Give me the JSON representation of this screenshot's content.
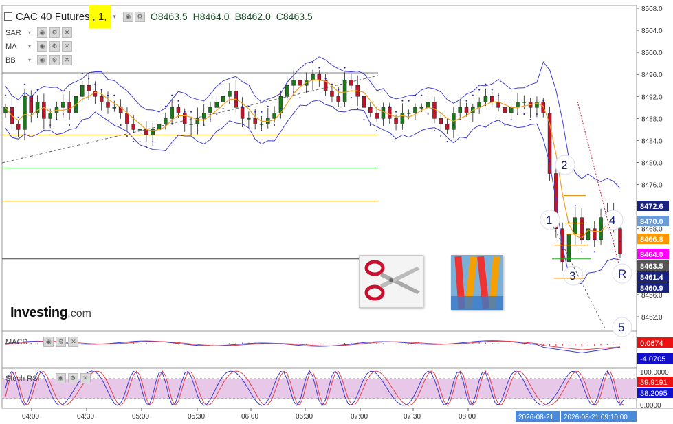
{
  "header": {
    "symbol_label": "CAC 40 Futures",
    "interval_label": ", 1,",
    "open": "O8463.5",
    "high": "H8464.0",
    "low": "B8462.0",
    "close": "C8463.5"
  },
  "indicators": [
    "SAR",
    "MA",
    "BB"
  ],
  "logo": "Investing",
  "logo_suffix": ".com",
  "macd_label": "MACD",
  "stoch_label": "Stoch RSI",
  "colors": {
    "up": "#1a7a1a",
    "down": "#c0142b",
    "bb": "#4040d0",
    "ma": "#f0a020",
    "sar": "#2222aa",
    "macd_line": "#3a3ad0",
    "signal_line": "#e0404a",
    "stoch_fill": "#e8c8e8",
    "yellow_line": "#d4a000",
    "green_line": "#22aa22",
    "orange_line": "#e08800"
  },
  "chart_data": [
    {
      "type": "candlestick",
      "title": "CAC 40 Futures, 1",
      "y_ticks": [
        "8508.0",
        "8504.0",
        "8500.0",
        "8496.0",
        "8492.0",
        "8488.0",
        "8484.0",
        "8480.0",
        "8476.0",
        "8472.0",
        "8468.0",
        "8464.0",
        "8460.0",
        "8456.0",
        "8452.0"
      ],
      "ylim": [
        8450,
        8509
      ],
      "x_ticks": [
        "04:00",
        "04:30",
        "05:00",
        "05:30",
        "06:00",
        "06:30",
        "07:00",
        "07:30",
        "08:00",
        "2026-08-21",
        "2026-08-21  09:10:00"
      ],
      "price_tags": [
        {
          "value": "8472.6",
          "color": "#1a237e"
        },
        {
          "value": "8470.0",
          "color": "#6a9bd8"
        },
        {
          "value": "8466.8",
          "color": "#ff9800"
        },
        {
          "value": "8464.0",
          "color": "#ff00ff"
        },
        {
          "value": "8463.5",
          "color": "#555555"
        },
        {
          "value": "8461.4",
          "color": "#1a237e"
        },
        {
          "value": "8460.9",
          "color": "#1a237e"
        }
      ],
      "horizontal_levels": [
        8485,
        8479,
        8473,
        8462.5
      ],
      "wave_labels": [
        "1",
        "2",
        "3",
        "4",
        "5",
        "R"
      ],
      "close_path": [
        8490,
        8487,
        8486,
        8492,
        8489,
        8491,
        8488,
        8489,
        8490,
        8491,
        8489,
        8492,
        8494,
        8493,
        8492,
        8491,
        8490,
        8490,
        8489,
        8487,
        8486,
        8486,
        8485,
        8486,
        8487,
        8488,
        8490,
        8489,
        8487,
        8487,
        8488,
        8489,
        8490,
        8491,
        8492,
        8493,
        8490,
        8488,
        8488,
        8487,
        8487,
        8488,
        8489,
        8492,
        8494,
        8495,
        8494,
        8495,
        8496,
        8495,
        8493,
        8492,
        8491,
        8495,
        8494,
        8492,
        8490,
        8489,
        8488,
        8490,
        8488,
        8487,
        8489,
        8489,
        8490,
        8490,
        8491,
        8488,
        8487,
        8486,
        8489,
        8490,
        8489,
        8490,
        8491,
        8492,
        8491,
        8490,
        8489,
        8490,
        8491,
        8491,
        8490,
        8491,
        8489,
        8478,
        8468,
        8462,
        8467,
        8470,
        8466,
        8468,
        8466,
        8470,
        8471,
        8468,
        8463.5
      ],
      "legend": null
    },
    {
      "type": "line",
      "title": "MACD",
      "series": [
        {
          "name": "0.0674",
          "color": "#3a3ad0"
        },
        {
          "name": "-4.0705",
          "color": "#e0404a"
        }
      ],
      "tags": [
        "0.0674",
        "-4.0705"
      ]
    },
    {
      "type": "line",
      "title": "Stoch RSI",
      "y_ticks": [
        "100.0000",
        "0.0000"
      ],
      "series": [
        {
          "name": "39.9191",
          "color": "#e0404a"
        },
        {
          "name": "38.2095",
          "color": "#3a3ad0"
        }
      ],
      "tags": [
        "39.9191",
        "38.2095"
      ]
    }
  ]
}
